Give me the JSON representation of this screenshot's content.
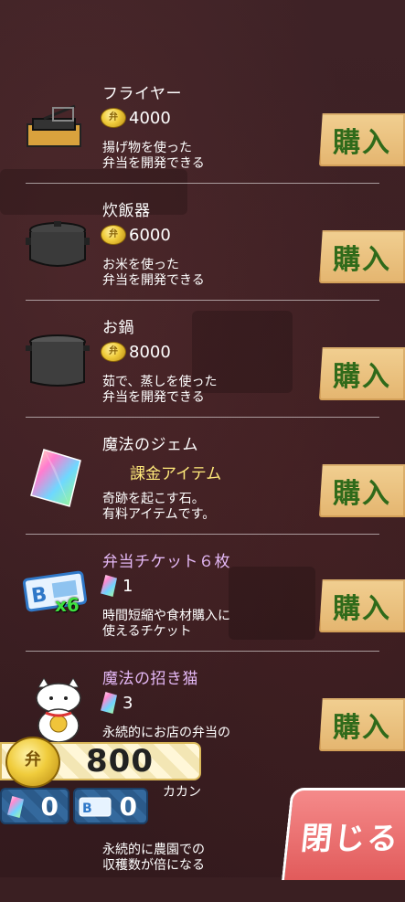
{
  "items": [
    {
      "name": "フライヤー",
      "price": "4000",
      "desc": "揚げ物を使った\n弁当を開発できる",
      "buy": "購入"
    },
    {
      "name": "炊飯器",
      "price": "6000",
      "desc": "お米を使った\n弁当を開発できる",
      "buy": "購入"
    },
    {
      "name": "お鍋",
      "price": "8000",
      "desc": "茹で、蒸しを使った\n弁当を開発できる",
      "buy": "購入"
    },
    {
      "name": "魔法のジェム",
      "paid": "課金アイテム",
      "desc": "奇跡を起こす石。\n有料アイテムです。",
      "buy": "購入"
    },
    {
      "name": "弁当チケット６枚",
      "gem_price": "1",
      "desc": "時間短縮や食材購入に\n使えるチケット",
      "buy": "購入",
      "ticket_badge": "x6"
    },
    {
      "name": "魔法の招き猫",
      "gem_price": "3",
      "desc": "永続的にお店の弁当の",
      "buy": "購入"
    },
    {
      "desc": "永続的に農園での\n収穫数が倍になる"
    }
  ],
  "coin_symbol": "弁",
  "hud": {
    "coins": "800",
    "gems": "0",
    "tickets": "0",
    "close_label": "閉じる",
    "partial_label": "カカン"
  },
  "colors": {
    "buy_text": "#2f6a1a",
    "buy_bg": "#e9c17e",
    "close_bg": "#e66a6a",
    "paid_text": "#ffe97a"
  }
}
